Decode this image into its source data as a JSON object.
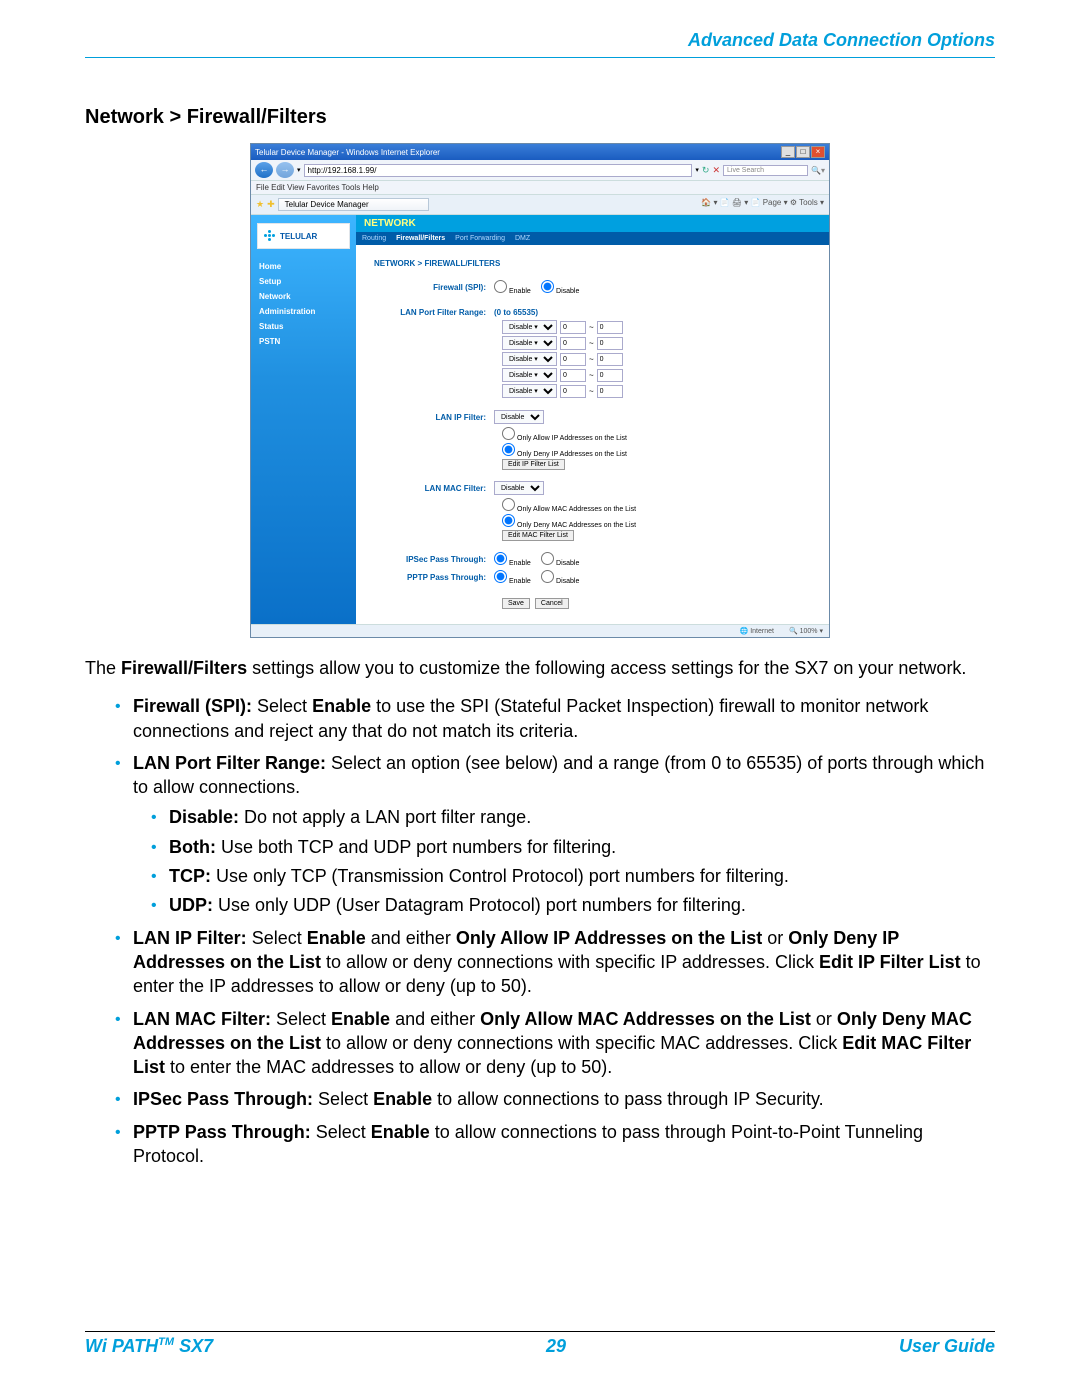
{
  "header": {
    "title": "Advanced Data Connection Options"
  },
  "section": {
    "heading": "Network > Firewall/Filters"
  },
  "screenshot": {
    "window_title": "Telular Device Manager - Windows Internet Explorer",
    "url": "http://192.168.1.99/",
    "searchbox": "Live Search",
    "menu": "File   Edit   View   Favorites   Tools   Help",
    "tab_name": "Telular Device Manager",
    "toolbar": "🏠 ▾  📄  🖨 ▾  📄 Page ▾  ⚙ Tools ▾",
    "logo": "TELULAR",
    "nav": [
      "Home",
      "Setup",
      "Network",
      "Administration",
      "Status",
      "PSTN"
    ],
    "section_header": "NETWORK",
    "subtabs": [
      "Routing",
      "Firewall/Filters",
      "Port Forwarding",
      "DMZ"
    ],
    "breadcrumb": "NETWORK > FIREWALL/FILTERS",
    "form": {
      "firewall_label": "Firewall (SPI):",
      "firewall_enable": "Enable",
      "firewall_disable": "Disable",
      "port_range_label": "LAN Port Filter Range:",
      "port_range_hint": "(0 to 65535)",
      "port_rows": [
        {
          "sel": "Disable",
          "from": "0",
          "dash": "~",
          "to": "0"
        },
        {
          "sel": "Disable",
          "from": "0",
          "dash": "~",
          "to": "0"
        },
        {
          "sel": "Disable",
          "from": "0",
          "dash": "~",
          "to": "0"
        },
        {
          "sel": "Disable",
          "from": "0",
          "dash": "~",
          "to": "0"
        },
        {
          "sel": "Disable",
          "from": "0",
          "dash": "~",
          "to": "0"
        }
      ],
      "ip_filter_label": "LAN IP Filter:",
      "ip_sel": "Disable",
      "ip_opt1": "Only Allow IP Addresses on the List",
      "ip_opt2": "Only Deny IP Addresses on the List",
      "ip_btn": "Edit IP Filter List",
      "mac_filter_label": "LAN MAC Filter:",
      "mac_sel": "Disable",
      "mac_opt1": "Only Allow MAC Addresses on the List",
      "mac_opt2": "Only Deny MAC Addresses on the List",
      "mac_btn": "Edit MAC Filter List",
      "ipsec_label": "IPSec Pass Through:",
      "pptp_label": "PPTP Pass Through:",
      "enable": "Enable",
      "disable": "Disable",
      "save": "Save",
      "cancel": "Cancel"
    },
    "status": {
      "zone": "Internet",
      "zoom": "🔍 100%  ▾"
    }
  },
  "body": {
    "intro_pre": "The ",
    "intro_bold": "Firewall/Filters",
    "intro_post": " settings allow you to customize the following access settings for the SX7 on your network.",
    "bullets": [
      {
        "bold": "Firewall (SPI):",
        "pre": " Select ",
        "b2": "Enable",
        "post": " to use the SPI (Stateful Packet Inspection) firewall to monitor network connections and reject any that do not match its criteria."
      },
      {
        "bold": "LAN Port Filter Range:",
        "post": " Select an option (see below) and a range (from 0 to 65535) of ports through which to allow connections.",
        "sub": [
          {
            "b": "Disable:",
            "t": " Do not apply a LAN port filter range."
          },
          {
            "b": "Both:",
            "t": " Use both TCP and UDP port numbers for filtering."
          },
          {
            "b": "TCP:",
            "t": " Use only TCP (Transmission Control Protocol) port numbers for filtering."
          },
          {
            "b": "UDP:",
            "t": " Use only UDP (User Datagram Protocol) port numbers for filtering."
          }
        ]
      },
      {
        "bold": "LAN IP Filter:",
        "parts": [
          " Select ",
          {
            "b": "Enable"
          },
          " and either ",
          {
            "b": "Only Allow IP Addresses on the List"
          },
          " or ",
          {
            "b": "Only Deny IP Addresses on the List"
          },
          " to allow or deny connections with specific IP addresses. Click ",
          {
            "b": "Edit IP Filter List"
          },
          " to enter the IP addresses to allow or deny (up to 50)."
        ]
      },
      {
        "bold": "LAN MAC Filter:",
        "parts": [
          " Select ",
          {
            "b": "Enable"
          },
          " and either ",
          {
            "b": "Only Allow MAC Addresses on the List"
          },
          " or ",
          {
            "b": "Only Deny MAC Addresses on the List"
          },
          " to allow or deny connections with specific MAC addresses. Click ",
          {
            "b": "Edit MAC Filter List"
          },
          " to enter the MAC addresses to allow or deny (up to 50)."
        ]
      },
      {
        "bold": "IPSec Pass Through:",
        "parts": [
          " Select ",
          {
            "b": "Enable"
          },
          " to allow connections to pass through IP Security."
        ]
      },
      {
        "bold": "PPTP Pass Through:",
        "parts": [
          " Select ",
          {
            "b": "Enable"
          },
          " to allow connections to pass through Point-to-Point Tunneling Protocol."
        ]
      }
    ]
  },
  "footer": {
    "left_pre": "Wi PATH",
    "left_post": " SX7",
    "center": "29",
    "right": "User Guide"
  }
}
